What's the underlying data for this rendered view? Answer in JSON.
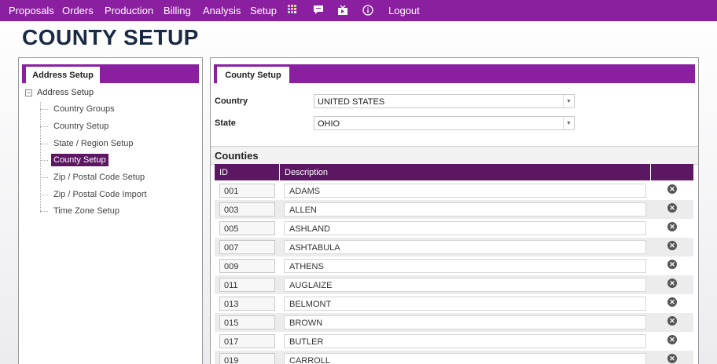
{
  "topnav": {
    "items": [
      "Proposals",
      "Orders",
      "Production",
      "Billing",
      "Analysis",
      "Setup"
    ],
    "icons": [
      "grid-icon",
      "chat-icon",
      "tv-icon",
      "info-icon"
    ],
    "logout": "Logout"
  },
  "page": {
    "title": "COUNTY SETUP"
  },
  "left": {
    "tab": "Address Setup",
    "tree_root": "Address Setup",
    "tree_items": [
      "Country Groups",
      "Country Setup",
      "State / Region Setup",
      "County Setup",
      "Zip / Postal Code Setup",
      "Zip / Postal Code Import",
      "Time Zone Setup"
    ],
    "selected": "County Setup"
  },
  "right": {
    "tab": "County Setup",
    "country_label": "Country",
    "country_value": "UNITED STATES",
    "state_label": "State",
    "state_value": "OHIO",
    "counties_heading": "Counties",
    "columns": [
      "ID",
      "Description"
    ],
    "rows": [
      {
        "id": "001",
        "desc": "ADAMS"
      },
      {
        "id": "003",
        "desc": "ALLEN"
      },
      {
        "id": "005",
        "desc": "ASHLAND"
      },
      {
        "id": "007",
        "desc": "ASHTABULA"
      },
      {
        "id": "009",
        "desc": "ATHENS"
      },
      {
        "id": "011",
        "desc": "AUGLAIZE"
      },
      {
        "id": "013",
        "desc": "BELMONT"
      },
      {
        "id": "015",
        "desc": "BROWN"
      },
      {
        "id": "017",
        "desc": "BUTLER"
      },
      {
        "id": "019",
        "desc": "CARROLL"
      }
    ]
  },
  "colors": {
    "brand": "#8a1fa0",
    "dark": "#5c1763"
  }
}
